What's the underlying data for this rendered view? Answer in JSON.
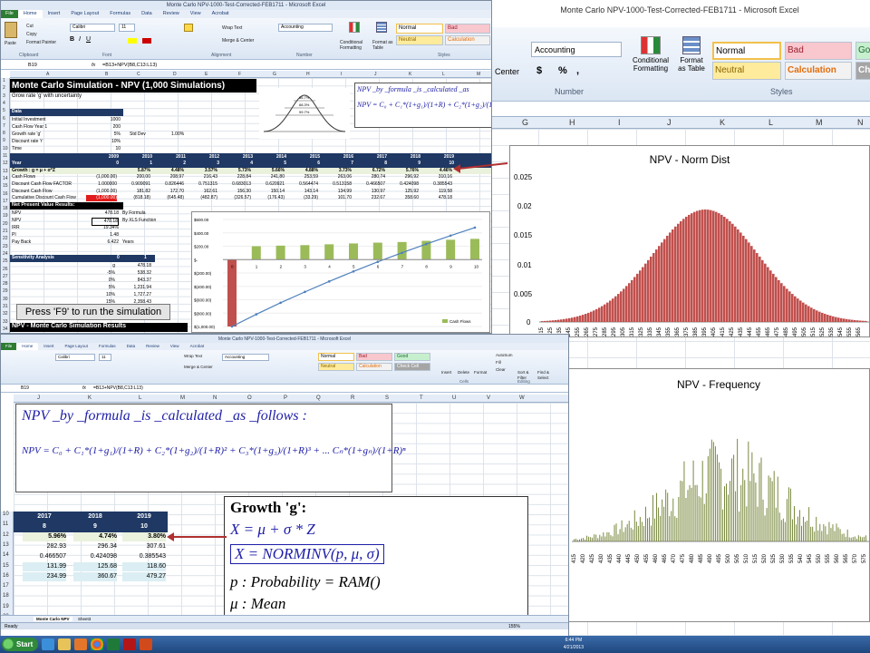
{
  "right_window": {
    "title": "Monte Carlo NPV-1000-Test-Corrected-FEB1711  -  Microsoft Excel",
    "number_format": "Accounting",
    "center_label": "Center",
    "symbols": [
      "$",
      "%",
      ","
    ],
    "cond_fmt": "Conditional Formatting",
    "fmt_table": "Format as Table",
    "number_group": "Number",
    "styles_group": "Styles",
    "styles": {
      "normal": "Normal",
      "bad": "Bad",
      "good": "Go",
      "neutral": "Neutral",
      "calculation": "Calculation",
      "check": "Ch"
    },
    "columns": [
      "G",
      "H",
      "I",
      "J",
      "K",
      "L",
      "M",
      "N"
    ],
    "chart_normdist": {
      "title": "NPV - Norm Dist",
      "yticks": [
        "0.025",
        "0.02",
        "0.015",
        "0.01",
        "0.005",
        "0"
      ]
    },
    "chart_freq": {
      "title": "NPV - Frequency"
    }
  },
  "top_window": {
    "title": "Monte Carlo NPV-1000-Test-Corrected-FEB1711 - Microsoft Excel",
    "tabs": [
      "File",
      "Home",
      "Insert",
      "Page Layout",
      "Formulas",
      "Data",
      "Review",
      "View",
      "Acrobat"
    ],
    "ribbon": {
      "paste": "Paste",
      "cut": "Cut",
      "copy": "Copy",
      "format_painter": "Format Painter",
      "font": "Calibri",
      "size": "11",
      "wrap": "Wrap Text",
      "merge": "Merge & Center",
      "number_format": "Accounting",
      "clipboard": "Clipboard",
      "font_group": "Font",
      "alignment": "Alignment",
      "number": "Number",
      "styles_group": "Styles",
      "cond_fmt": "Conditional Formatting",
      "fmt_table": "Format as Table",
      "styles": {
        "normal": "Normal",
        "bad": "Bad",
        "neutral": "Neutral",
        "calculation": "Calculation"
      }
    },
    "cell_ref": "B19",
    "formula": "=B13+NPV(B8,C13:L13)",
    "columns": [
      "A",
      "B",
      "C",
      "D",
      "E",
      "F",
      "G",
      "H",
      "I",
      "J",
      "K",
      "L",
      "M"
    ],
    "sheet_title": "Monte Carlo Simulation  - NPV (1,000 Simulations)",
    "subtitle": "Grow rate 'g' with uncertainty",
    "data_label": "Data",
    "inputs": [
      {
        "label": "Initial Investment",
        "value": "1000"
      },
      {
        "label": "Cash Flow Year 1",
        "value": "200"
      },
      {
        "label": "Growth rate 'g'",
        "value": "5%",
        "extra": "Std Dev",
        "extra_val": "1.00%"
      },
      {
        "label": "Discount rate 'r'",
        "value": "10%"
      },
      {
        "label": "Time",
        "value": "10"
      }
    ],
    "years": [
      "2009",
      "2010",
      "2011",
      "2012",
      "2013",
      "2014",
      "2015",
      "2016",
      "2017",
      "2018",
      "2019"
    ],
    "periods": [
      "0",
      "1",
      "2",
      "3",
      "4",
      "5",
      "6",
      "7",
      "8",
      "9",
      "10"
    ],
    "row_labels": [
      "Year",
      "Growth : g = μ + σ*Z",
      "Cash Flows",
      "Discount Cash Flow FACTOR",
      "Discount Cash Flow",
      "Cumulative Discount Cash Flow"
    ],
    "growth": [
      "",
      "5.87%",
      "4.48%",
      "3.57%",
      "5.73%",
      "5.66%",
      "4.88%",
      "3.73%",
      "6.72%",
      "5.76%",
      "4.46%"
    ],
    "cash_flows": [
      "(1,000.00)",
      "200.00",
      "208.97",
      "216.43",
      "228.84",
      "241.80",
      "253.59",
      "263.06",
      "280.74",
      "296.92",
      "310.16"
    ],
    "factor": [
      "1.000000",
      "0.909091",
      "0.826446",
      "0.751315",
      "0.683013",
      "0.620921",
      "0.564474",
      "0.513158",
      "0.466507",
      "0.424098",
      "0.385543"
    ],
    "dcf": [
      "(1,000.00)",
      "181.82",
      "172.70",
      "162.61",
      "156.30",
      "150.14",
      "143.14",
      "134.99",
      "130.97",
      "125.92",
      "119.58"
    ],
    "cum_dcf": [
      "(1,000.00)",
      "(818.18)",
      "(645.48)",
      "(482.87)",
      "(326.57)",
      "(176.43)",
      "(33.29)",
      "101.70",
      "232.67",
      "358.60",
      "478.18"
    ],
    "npv_results_label": "Net Present Value Results:",
    "npv_rows": [
      {
        "label": "NPV",
        "value": "478.18",
        "note": "By Formula"
      },
      {
        "label": "NPV",
        "value": "478.18",
        "note": "By XLS Function"
      },
      {
        "label": "IRR",
        "value": "19.34%",
        "note": ""
      },
      {
        "label": "PI",
        "value": "1.48",
        "note": ""
      },
      {
        "label": "Pay Back",
        "value": "6.422",
        "note": "Years"
      }
    ],
    "sensitivity_label": "Sensitivity Analysis",
    "sens_head": [
      "0",
      "1"
    ],
    "sens_rows": [
      {
        "g": "g",
        "v": "478.18"
      },
      {
        "g": "-5%",
        "v": "538.32"
      },
      {
        "g": "0%",
        "v": "843.37"
      },
      {
        "g": "5%",
        "v": "1,231.94"
      },
      {
        "g": "10%",
        "v": "1,727.27"
      },
      {
        "g": "15%",
        "v": "2,358.43"
      }
    ],
    "run_button": "Press 'F9' to run the simulation",
    "mc_results": "NPV - Monte Carlo Simulation Results",
    "formula_box": {
      "line1": "NPV _by _formula _is _calculated _as",
      "line2": "NPV = C₀ + C₁*(1+g₁)/(1+R) + C₂*(1+g₂)/(1+R)²"
    },
    "mini_chart": {
      "labels": [
        "86.7%",
        "68.3%",
        "99.7%"
      ]
    },
    "cf_chart": {
      "yticks": [
        "$600.00",
        "$400.00",
        "$200.00",
        "$-",
        "$(200.00)",
        "$(400.00)",
        "$(600.00)",
        "$(800.00)",
        "$(1,000.00)"
      ],
      "xticks": [
        "0",
        "1",
        "2",
        "3",
        "4",
        "5",
        "6",
        "7",
        "8",
        "9",
        "10"
      ],
      "legend": "Cash Flows"
    },
    "rows": [
      "1",
      "2",
      "3",
      "4",
      "5",
      "6",
      "7",
      "8",
      "9",
      "10",
      "11",
      "12",
      "13",
      "14",
      "15",
      "16",
      "17",
      "18",
      "19",
      "20",
      "21",
      "22",
      "23",
      "24",
      "25",
      "26",
      "27",
      "28",
      "29",
      "30",
      "31",
      "32",
      "33",
      "34"
    ]
  },
  "bottom_window": {
    "title": "Monte Carlo NPV-1000-Test-Corrected-FEB1711 - Microsoft Excel",
    "tabs": [
      "File",
      "Home",
      "Insert",
      "Page Layout",
      "Formulas",
      "Data",
      "Review",
      "View",
      "Acrobat"
    ],
    "ribbon": {
      "font": "Calibri",
      "size": "11",
      "wrap": "Wrap Text",
      "merge": "Merge & Center",
      "number_format": "Accounting",
      "styles": {
        "normal": "Normal",
        "bad": "Bad",
        "good": "Good",
        "neutral": "Neutral",
        "calculation": "Calculation",
        "check": "Check Cell"
      },
      "insert": "Insert",
      "delete": "Delete",
      "format": "Format",
      "autosum": "AutoSum",
      "fill": "Fill",
      "clear": "Clear",
      "sort": "Sort & Filter",
      "find": "Find & Select",
      "cells": "Cells",
      "editing": "Editing"
    },
    "cell_ref": "B19",
    "formula": "=B13+NPV(B8,C13:L13)",
    "columns": [
      "J",
      "K",
      "L",
      "M",
      "N",
      "O",
      "P",
      "Q",
      "R",
      "S",
      "T",
      "U",
      "V",
      "W"
    ],
    "rows": [
      "10",
      "11",
      "12",
      "13",
      "14",
      "15",
      "16",
      "17",
      "18",
      "19",
      "20"
    ],
    "formula_title": "NPV _by _formula _is _calculated _as _follows :",
    "formula_eq": "NPV = C₀ + C₁*(1+g₁)/(1+R) + C₂*(1+g₂)/(1+R)² + C₃*(1+g₃)/(1+R)³ + ... Cₙ*(1+gₙ)/(1+R)ⁿ",
    "years": [
      "2017",
      "2018",
      "2019"
    ],
    "periods": [
      "8",
      "9",
      "10"
    ],
    "growth": [
      "5.96%",
      "4.74%",
      "3.80%"
    ],
    "cash": [
      "282.93",
      "296.34",
      "307.61"
    ],
    "factor": [
      "0.466507",
      "0.424098",
      "0.385543"
    ],
    "dcf": [
      "131.99",
      "125.68",
      "118.60"
    ],
    "cum": [
      "234.99",
      "360.67",
      "479.27"
    ],
    "growth_box": {
      "title": "Growth 'g':",
      "eq1": "X = μ + σ * Z",
      "eq2": "X = NORMINV(p, μ, σ)",
      "eq3": "p : Probability = RAM()",
      "eq4": "μ : Mean"
    },
    "sheet_tabs": [
      "Monte Carlo NPV",
      "Sheet3"
    ],
    "status_ready": "Ready",
    "zoom": "155%"
  },
  "taskbar": {
    "start": "Start",
    "time": "6:44 PM",
    "date": "4/21/2013"
  }
}
